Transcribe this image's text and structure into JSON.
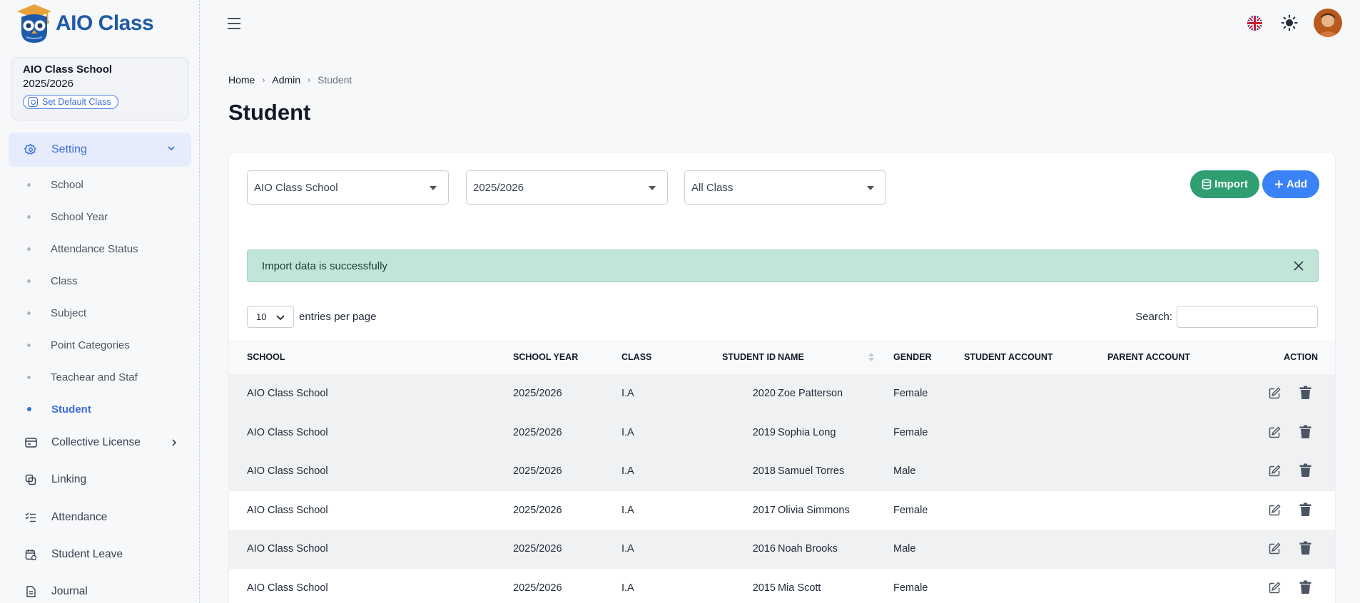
{
  "app": {
    "logo_text": "AIO Class"
  },
  "school_card": {
    "name": "AIO Class School",
    "year": "2025/2026",
    "default_button": "Set Default Class"
  },
  "sidebar": {
    "setting_label": "Setting",
    "sub_items": [
      {
        "label": "School",
        "active": false
      },
      {
        "label": "School Year",
        "active": false
      },
      {
        "label": "Attendance Status",
        "active": false
      },
      {
        "label": "Class",
        "active": false
      },
      {
        "label": "Subject",
        "active": false
      },
      {
        "label": "Point Categories",
        "active": false
      },
      {
        "label": "Teachear and Staf",
        "active": false
      },
      {
        "label": "Student",
        "active": true
      }
    ],
    "items": [
      {
        "label": "Collective License",
        "icon": "card-icon"
      },
      {
        "label": "Linking",
        "icon": "copy-icon"
      },
      {
        "label": "Attendance",
        "icon": "checklist-icon"
      },
      {
        "label": "Student Leave",
        "icon": "calendar-icon"
      },
      {
        "label": "Journal",
        "icon": "document-icon"
      }
    ]
  },
  "breadcrumb": {
    "home": "Home",
    "admin": "Admin",
    "current": "Student"
  },
  "page": {
    "title": "Student"
  },
  "filters": {
    "school": "AIO Class School",
    "year": "2025/2026",
    "class": "All Class"
  },
  "buttons": {
    "import": "Import",
    "add": "Add"
  },
  "alert": {
    "message": "Import data is successfully"
  },
  "table_controls": {
    "entries_value": "10",
    "entries_label": "entries per page",
    "search_label": "Search:"
  },
  "table": {
    "headers": {
      "school": "SCHOOL",
      "year": "SCHOOL YEAR",
      "class": "CLASS",
      "sid": "STUDENT ID",
      "name": "NAME",
      "gender": "GENDER",
      "sacc": "STUDENT ACCOUNT",
      "pacc": "PARENT ACCOUNT",
      "action": "ACTION"
    },
    "rows": [
      {
        "school": "AIO Class School",
        "year": "2025/2026",
        "class": "I.A",
        "sid": "2020",
        "name": "Zoe Patterson",
        "gender": "Female",
        "sacc": "",
        "pacc": ""
      },
      {
        "school": "AIO Class School",
        "year": "2025/2026",
        "class": "I.A",
        "sid": "2019",
        "name": "Sophia Long",
        "gender": "Female",
        "sacc": "",
        "pacc": ""
      },
      {
        "school": "AIO Class School",
        "year": "2025/2026",
        "class": "I.A",
        "sid": "2018",
        "name": "Samuel Torres",
        "gender": "Male",
        "sacc": "",
        "pacc": ""
      },
      {
        "school": "AIO Class School",
        "year": "2025/2026",
        "class": "I.A",
        "sid": "2017",
        "name": "Olivia Simmons",
        "gender": "Female",
        "sacc": "",
        "pacc": ""
      },
      {
        "school": "AIO Class School",
        "year": "2025/2026",
        "class": "I.A",
        "sid": "2016",
        "name": "Noah Brooks",
        "gender": "Male",
        "sacc": "",
        "pacc": ""
      },
      {
        "school": "AIO Class School",
        "year": "2025/2026",
        "class": "I.A",
        "sid": "2015",
        "name": "Mia Scott",
        "gender": "Female",
        "sacc": "",
        "pacc": ""
      }
    ]
  },
  "colors": {
    "accent": "#3b6fd8",
    "import_green": "#2f9e71",
    "add_blue": "#3b82f6",
    "alert_bg": "#c1e5d6"
  }
}
